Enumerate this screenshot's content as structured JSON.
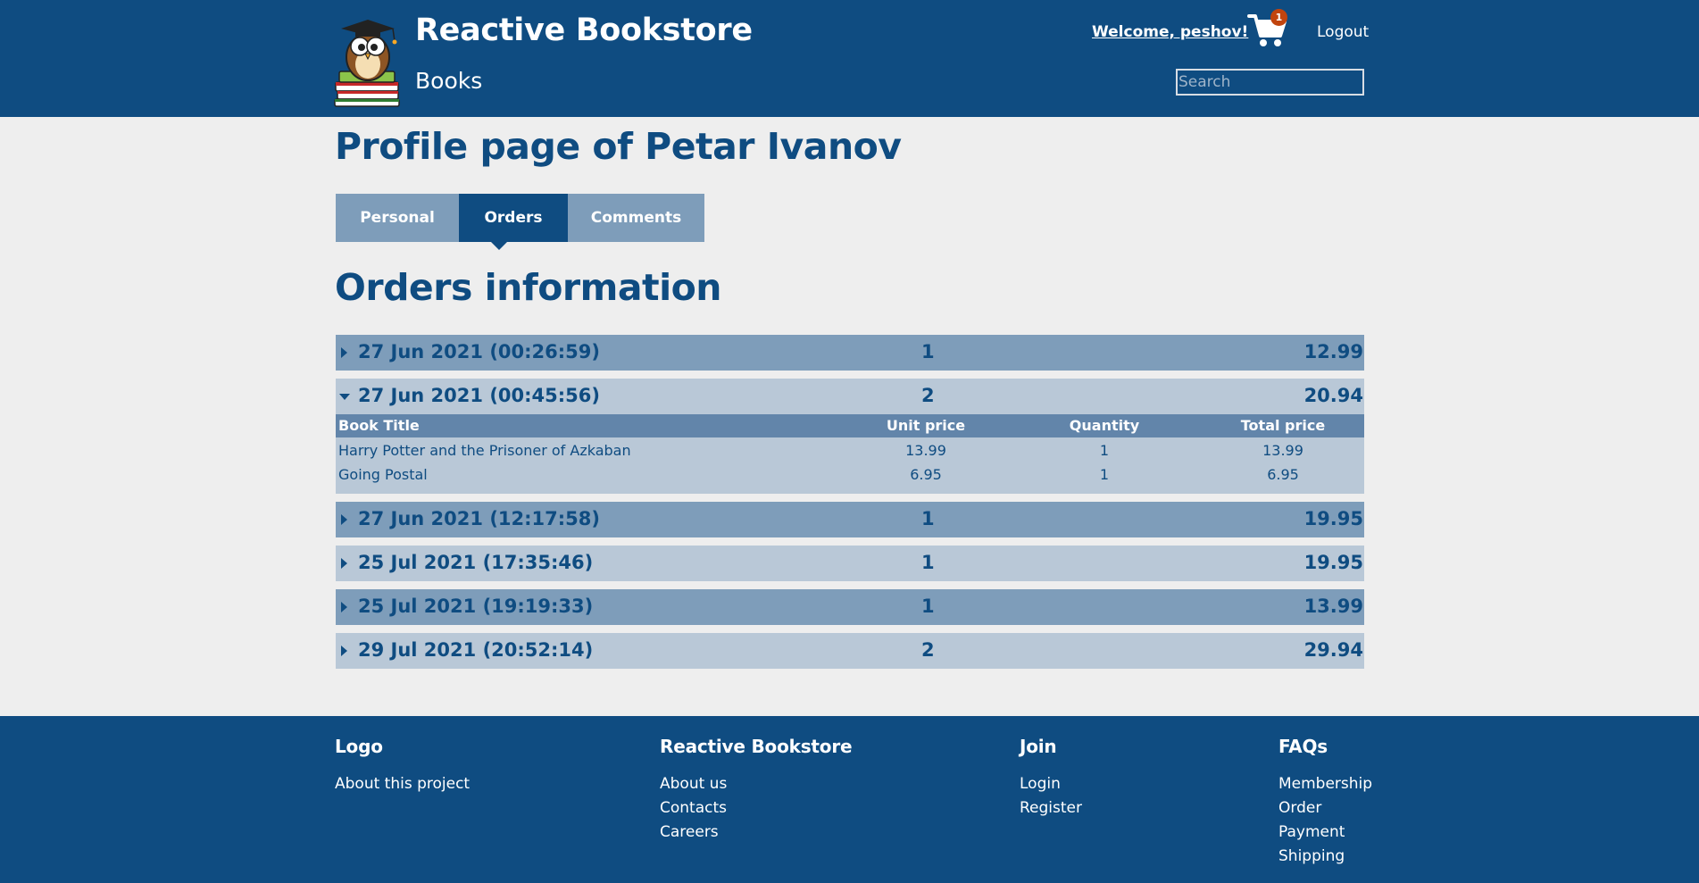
{
  "header": {
    "title": "Reactive Bookstore",
    "subtitle": "Books",
    "welcome": "Welcome, peshov!",
    "cart_count": "1",
    "logout": "Logout",
    "search_placeholder": "Search"
  },
  "profile": {
    "title": "Profile page of Petar Ivanov",
    "tabs": [
      "Personal",
      "Orders",
      "Comments"
    ],
    "active_tab": "Orders"
  },
  "orders": {
    "title": "Orders information",
    "columns": [
      "Book Title",
      "Unit price",
      "Quantity",
      "Total price"
    ],
    "rows": [
      {
        "date": "27 Jun 2021 (00:26:59)",
        "count": "1",
        "total": "12.99"
      },
      {
        "date": "27 Jun 2021 (00:45:56)",
        "count": "2",
        "total": "20.94",
        "items": [
          {
            "title": "Harry Potter and the Prisoner of Azkaban",
            "unit": "13.99",
            "qty": "1",
            "total": "13.99"
          },
          {
            "title": "Going Postal",
            "unit": "6.95",
            "qty": "1",
            "total": "6.95"
          }
        ]
      },
      {
        "date": "27 Jun 2021 (12:17:58)",
        "count": "1",
        "total": "19.95"
      },
      {
        "date": "25 Jul 2021 (17:35:46)",
        "count": "1",
        "total": "19.95"
      },
      {
        "date": "25 Jul 2021 (19:19:33)",
        "count": "1",
        "total": "13.99"
      },
      {
        "date": "29 Jul 2021 (20:52:14)",
        "count": "2",
        "total": "29.94"
      }
    ]
  },
  "footer": {
    "columns": [
      {
        "title": "Logo",
        "links": [
          "About this project"
        ]
      },
      {
        "title": "Reactive Bookstore",
        "links": [
          "About us",
          "Contacts",
          "Careers"
        ]
      },
      {
        "title": "Join",
        "links": [
          "Login",
          "Register"
        ]
      },
      {
        "title": "FAQs",
        "links": [
          "Membership",
          "Order",
          "Payment",
          "Shipping"
        ]
      }
    ]
  },
  "colors": {
    "primary": "#0f4c81",
    "row_dark": "#7e9dba",
    "row_light": "#b9c8d7",
    "table_head": "#6285aa",
    "badge": "#c1440e",
    "background": "#eeeeee"
  },
  "icons": {
    "logo": "owl-graduate-books-logo",
    "cart": "shopping-cart-icon",
    "collapsed": "caret-right-icon",
    "expanded": "caret-down-icon"
  }
}
